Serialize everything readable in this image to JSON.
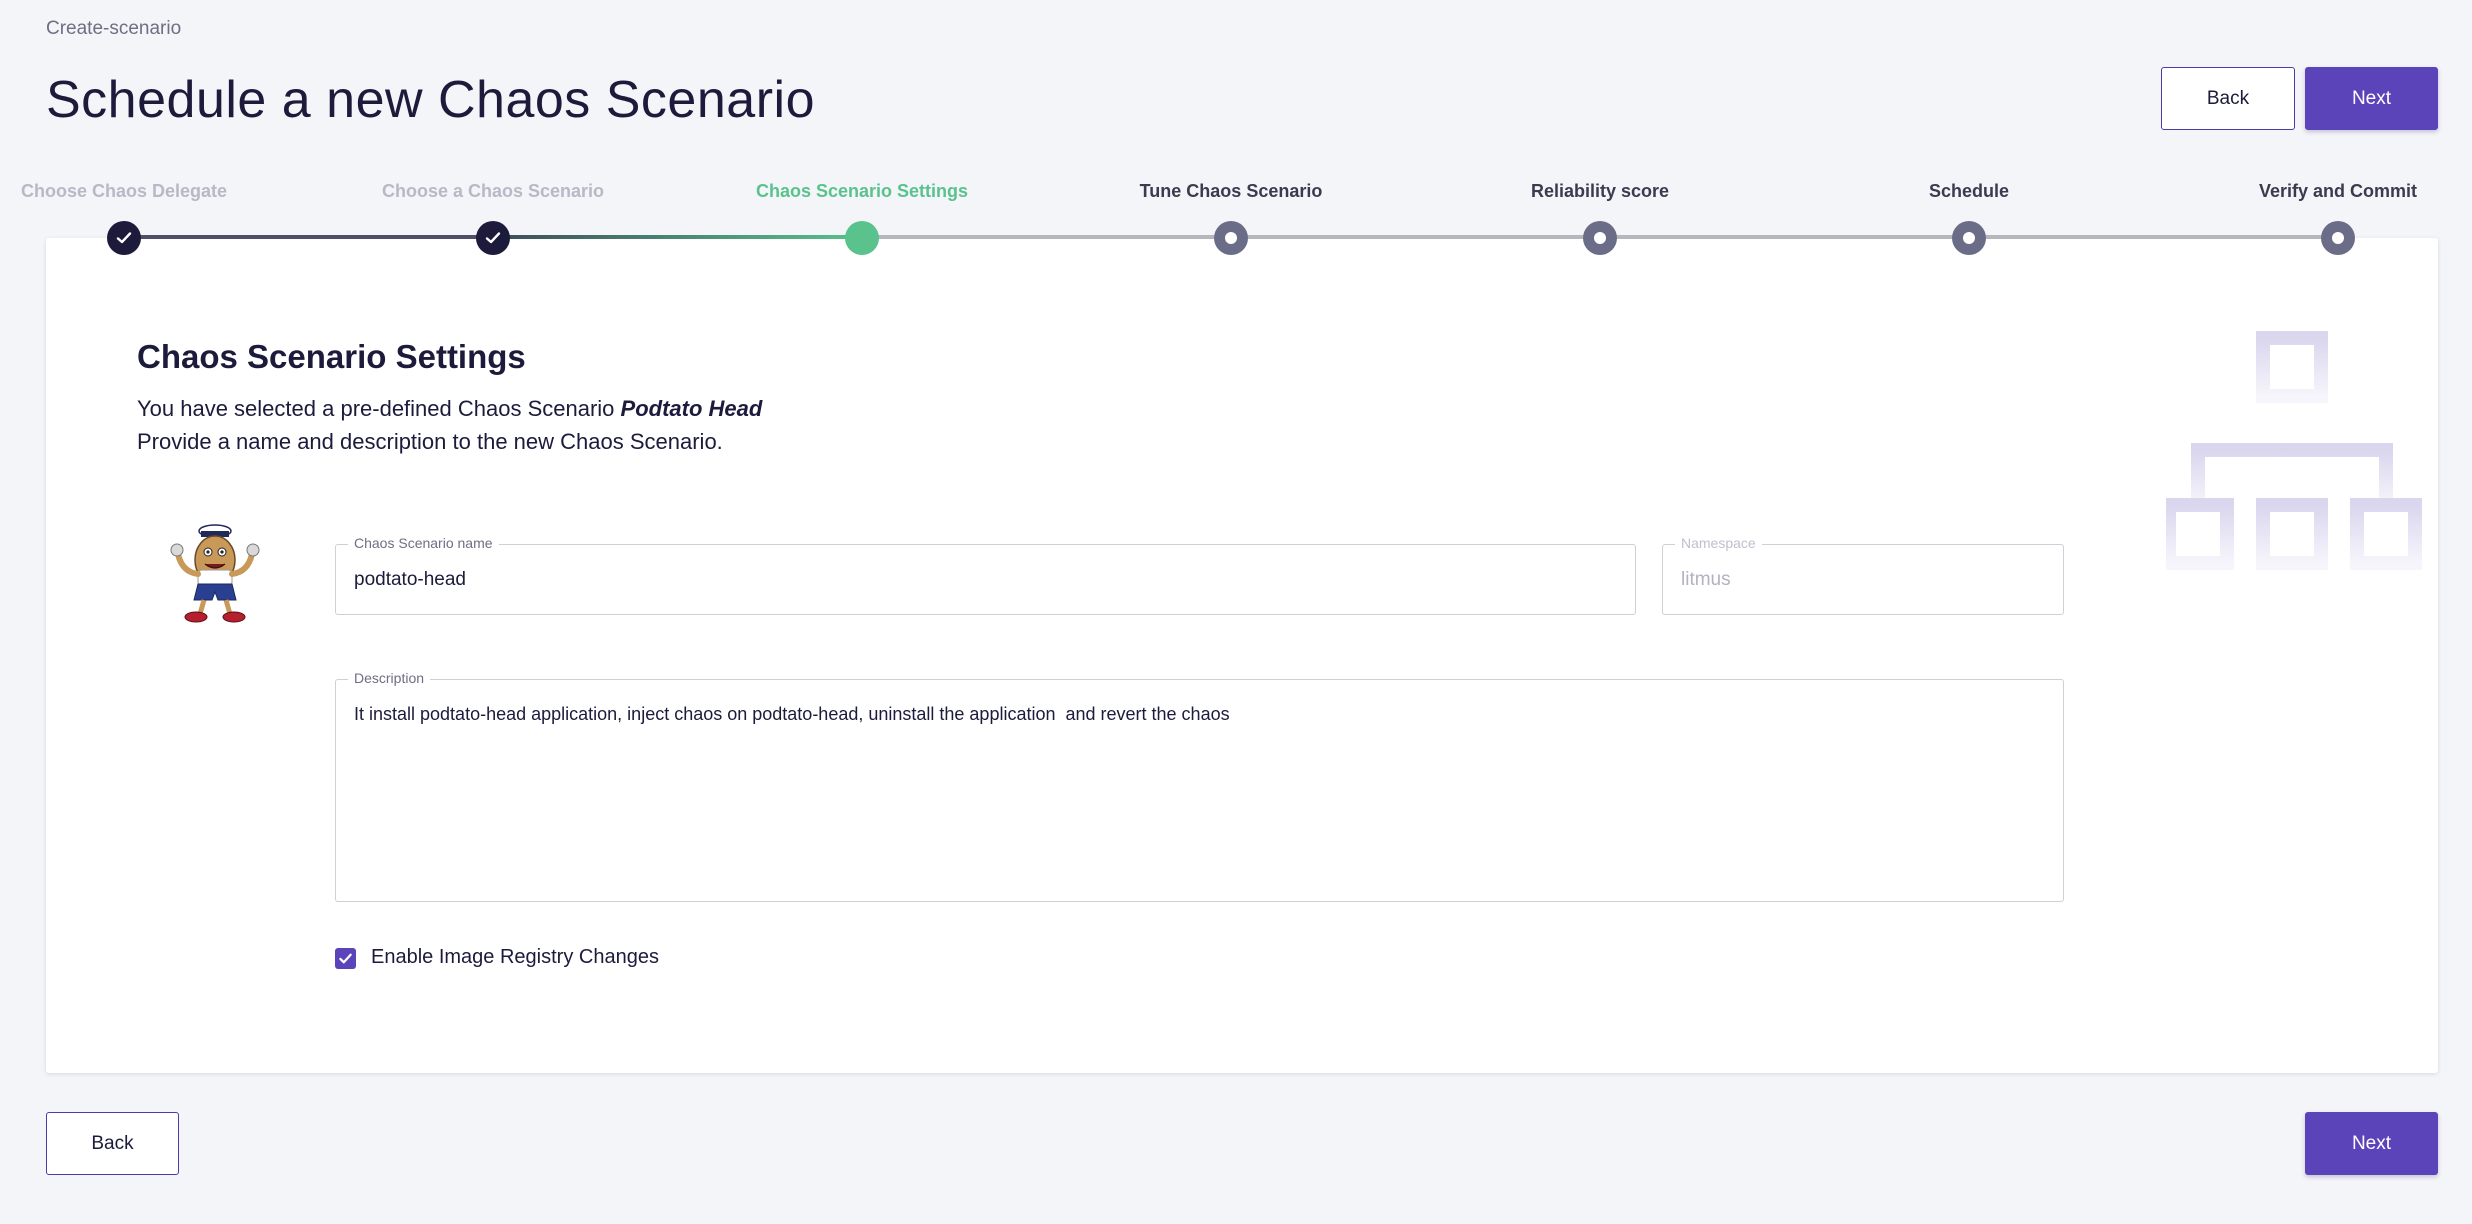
{
  "breadcrumb": "Create-scenario",
  "page_title": "Schedule a new Chaos Scenario",
  "header_actions": {
    "back_label": "Back",
    "next_label": "Next"
  },
  "stepper": {
    "steps": [
      {
        "label": "Choose Chaos Delegate",
        "state": "done"
      },
      {
        "label": "Choose a Chaos Scenario",
        "state": "done"
      },
      {
        "label": "Chaos Scenario Settings",
        "state": "active"
      },
      {
        "label": "Tune Chaos Scenario",
        "state": "todo"
      },
      {
        "label": "Reliability score",
        "state": "todo"
      },
      {
        "label": "Schedule",
        "state": "todo"
      },
      {
        "label": "Verify and Commit",
        "state": "todo"
      }
    ]
  },
  "settings": {
    "title": "Chaos Scenario Settings",
    "intro_prefix": "You have selected a pre-defined Chaos Scenario ",
    "scenario_name_emphasis": "Podtato Head",
    "intro_line2": "Provide a name and description to the new Chaos Scenario.",
    "name_field": {
      "label": "Chaos Scenario name",
      "value": "podtato-head"
    },
    "namespace_field": {
      "label": "Namespace",
      "value": "litmus",
      "disabled": true
    },
    "description_field": {
      "label": "Description",
      "value": "It install podtato-head application, inject chaos on podtato-head, uninstall the application  and revert the chaos"
    },
    "image_registry_checkbox": {
      "label": "Enable Image Registry Changes",
      "checked": true
    }
  },
  "icons": {
    "mascot": "podtato-head-mascot-icon",
    "watermark": "workflow-tree-icon",
    "check": "check-icon"
  },
  "footer_actions": {
    "back_label": "Back",
    "next_label": "Next"
  },
  "colors": {
    "primary": "#5b44ba",
    "active_step": "#5ac28d",
    "done_step": "#1c1b3b",
    "todo_step": "#6b6d88"
  }
}
